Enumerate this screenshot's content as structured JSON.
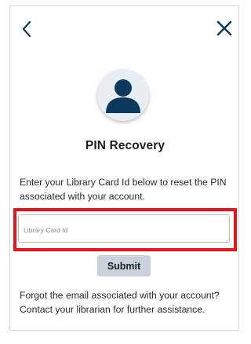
{
  "colors": {
    "accent": "#0d3a5c",
    "highlight": "#e8141b",
    "button_bg": "#c9d2da",
    "avatar_bg": "#e9eef2"
  },
  "header": {
    "back_icon": "chevron-left-icon",
    "close_icon": "close-icon"
  },
  "avatar": {
    "icon": "user-icon"
  },
  "title": "PIN Recovery",
  "instructions": "Enter your Library Card Id below to reset the PIN associated with your account.",
  "form": {
    "card_id": {
      "placeholder": "Library Card Id",
      "value": ""
    },
    "submit_label": "Submit"
  },
  "footer": "Forgot the email associated with your account? Contact your librarian for further assistance."
}
